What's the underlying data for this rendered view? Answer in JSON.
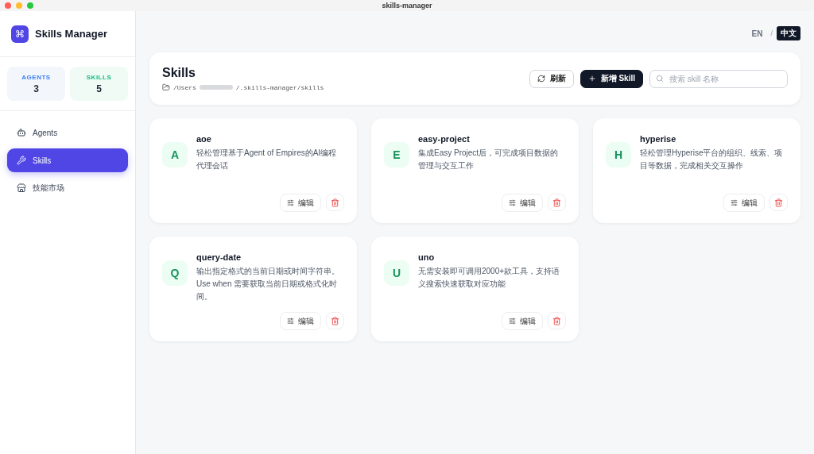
{
  "window": {
    "title": "skills-manager"
  },
  "sidebar": {
    "app_icon": "⌘",
    "app_name": "Skills Manager",
    "stats": [
      {
        "label": "AGENTS",
        "value": "3",
        "color": "#3b82f6"
      },
      {
        "label": "SKILLS",
        "value": "5",
        "color": "#10b981"
      }
    ],
    "items": [
      {
        "label": "Agents",
        "selected": false
      },
      {
        "label": "Skills",
        "selected": true
      },
      {
        "label": "技能市场",
        "selected": false
      }
    ]
  },
  "language": {
    "options": [
      {
        "label": "EN",
        "selected": false
      },
      {
        "label": "中文",
        "selected": true
      }
    ],
    "separator": "/"
  },
  "header": {
    "title": "Skills",
    "path_prefix": "/Users",
    "path_suffix": "/.skills-manager/skills",
    "refresh": "刷新",
    "add": "新增 Skill",
    "search": {
      "placeholder": "搜索 skill 名称"
    }
  },
  "skills": [
    {
      "initial": "A",
      "name": "aoe",
      "description": "轻松管理基于Agent of Empires的AI编程代理会话",
      "edit": "编辑"
    },
    {
      "initial": "E",
      "name": "easy-project",
      "description": "集成Easy Project后，可完成项目数据的管理与交互工作",
      "edit": "编辑"
    },
    {
      "initial": "H",
      "name": "hyperise",
      "description": "轻松管理Hyperise平台的组织、线索、项目等数据，完成相关交互操作",
      "edit": "编辑"
    },
    {
      "initial": "Q",
      "name": "query-date",
      "description": "输出指定格式的当前日期或时间字符串。Use when 需要获取当前日期或格式化时间。",
      "edit": "编辑"
    },
    {
      "initial": "U",
      "name": "uno",
      "description": "无需安装即可调用2000+款工具，支持语义搜索快速获取对应功能",
      "edit": "编辑"
    }
  ]
}
